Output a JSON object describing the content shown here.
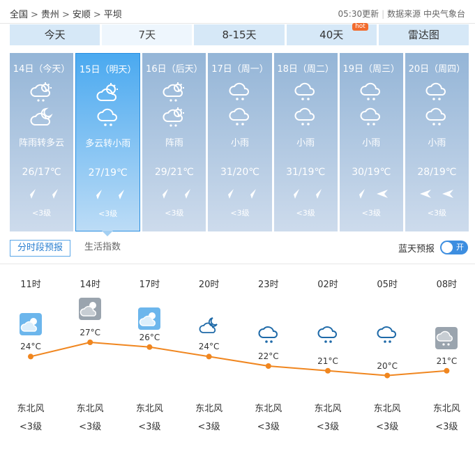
{
  "breadcrumb": [
    "全国",
    "贵州",
    "安顺",
    "平坝"
  ],
  "breadcrumb_sep": ">",
  "update": {
    "time": "05:30更新",
    "source": "数据来源 中央气象台"
  },
  "tabs": [
    {
      "label": "今天"
    },
    {
      "label": "7天",
      "active": true
    },
    {
      "label": "8-15天"
    },
    {
      "label": "40天",
      "badge": "hot"
    },
    {
      "label": "雷达图"
    }
  ],
  "days": [
    {
      "label": "14日（今天）",
      "icon1": "cloud-rain-sun-icon",
      "icon2": "partly-cloudy-night-icon",
      "desc": "阵雨转多云",
      "temp": "26/17℃",
      "wind1": "northeast",
      "wind2": "northeast",
      "level": "<3级"
    },
    {
      "label": "15日（明天）",
      "icon1": "partly-cloudy-icon",
      "icon2": "light-rain-icon",
      "desc": "多云转小雨",
      "temp": "27/19℃",
      "wind1": "northeast",
      "wind2": "northeast",
      "level": "<3级",
      "active": true
    },
    {
      "label": "16日（后天）",
      "icon1": "cloud-rain-sun-icon",
      "icon2": "cloud-rain-sun-icon",
      "desc": "阵雨",
      "temp": "29/21℃",
      "wind1": "northeast",
      "wind2": "northeast",
      "level": "<3级"
    },
    {
      "label": "17日（周一）",
      "icon1": "light-rain-icon",
      "icon2": "light-rain-icon",
      "desc": "小雨",
      "temp": "31/20℃",
      "wind1": "northeast",
      "wind2": "northeast",
      "level": "<3级"
    },
    {
      "label": "18日（周二）",
      "icon1": "light-rain-icon",
      "icon2": "light-rain-icon",
      "desc": "小雨",
      "temp": "31/19℃",
      "wind1": "northeast",
      "wind2": "northeast",
      "level": "<3级"
    },
    {
      "label": "19日（周三）",
      "icon1": "light-rain-icon",
      "icon2": "light-rain-icon",
      "desc": "小雨",
      "temp": "30/19℃",
      "wind1": "northeast",
      "wind2": "east",
      "level": "<3级"
    },
    {
      "label": "20日（周四）",
      "icon1": "light-rain-icon",
      "icon2": "light-rain-icon",
      "desc": "小雨",
      "temp": "28/19℃",
      "wind1": "east",
      "wind2": "east",
      "level": "<3级"
    }
  ],
  "subtabs": [
    {
      "label": "分时段预报",
      "active": true
    },
    {
      "label": "生活指数"
    }
  ],
  "blue_sky": {
    "label": "蓝天预报",
    "toggle": "开"
  },
  "hourly": [
    {
      "time": "11时",
      "icon": "partly-cloudy-icon",
      "temp": 24,
      "wind": "东北风",
      "level": "<3级"
    },
    {
      "time": "14时",
      "icon": "overcast-sun-icon",
      "temp": 27,
      "wind": "东北风",
      "level": "<3级"
    },
    {
      "time": "17时",
      "icon": "partly-cloudy-icon",
      "temp": 26,
      "wind": "东北风",
      "level": "<3级"
    },
    {
      "time": "20时",
      "icon": "partly-cloudy-night-icon",
      "temp": 24,
      "wind": "东北风",
      "level": "<3级"
    },
    {
      "time": "23时",
      "icon": "light-rain-icon",
      "temp": 22,
      "wind": "东北风",
      "level": "<3级"
    },
    {
      "time": "02时",
      "icon": "light-rain-icon",
      "temp": 21,
      "wind": "东北风",
      "level": "<3级"
    },
    {
      "time": "05时",
      "icon": "light-rain-icon",
      "temp": 20,
      "wind": "东北风",
      "level": "<3级"
    },
    {
      "time": "08时",
      "icon": "overcast-rain-icon",
      "temp": 21,
      "wind": "东北风",
      "level": "<3级"
    }
  ],
  "temp_unit": "°C",
  "colors": {
    "accent": "#2a8fe0",
    "line": "#f0861f",
    "day_bg": "#94b5d7",
    "active_day_bg": "#4aa9f0",
    "hot": "#f26b2d"
  }
}
